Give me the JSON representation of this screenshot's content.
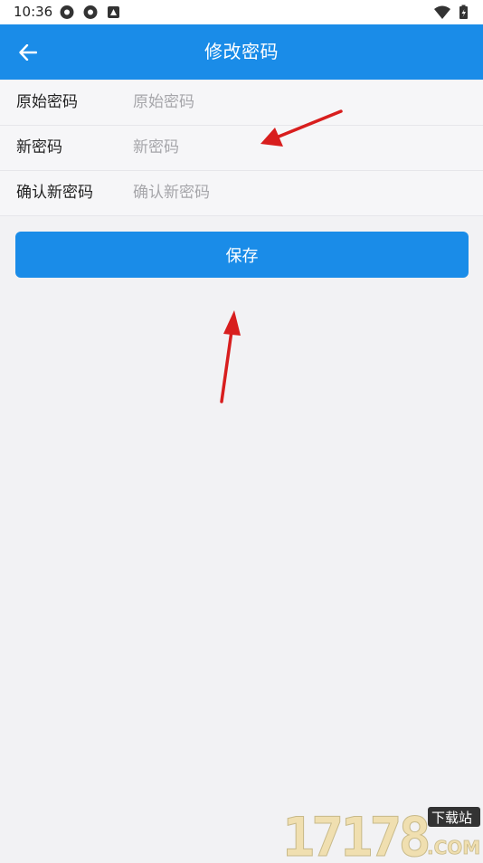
{
  "status_bar": {
    "time": "10:36",
    "left_icons": [
      "app-notification-icon",
      "app-notification-icon",
      "system-notification-icon"
    ],
    "right_icons": [
      "wifi-icon",
      "battery-icon"
    ]
  },
  "app_bar": {
    "title": "修改密码",
    "background": "#1a8ce8",
    "back_icon": "arrow-left-icon"
  },
  "form": {
    "fields": [
      {
        "label": "原始密码",
        "placeholder": "原始密码",
        "value": ""
      },
      {
        "label": "新密码",
        "placeholder": "新密码",
        "value": ""
      },
      {
        "label": "确认新密码",
        "placeholder": "确认新密码",
        "value": ""
      }
    ]
  },
  "actions": {
    "save_label": "保存",
    "accent": "#1a8ce8"
  },
  "annotations": {
    "arrow_color": "#d81e1e"
  },
  "watermark": {
    "digits": "17178",
    "site": "下载站",
    "domain": ".COM"
  }
}
